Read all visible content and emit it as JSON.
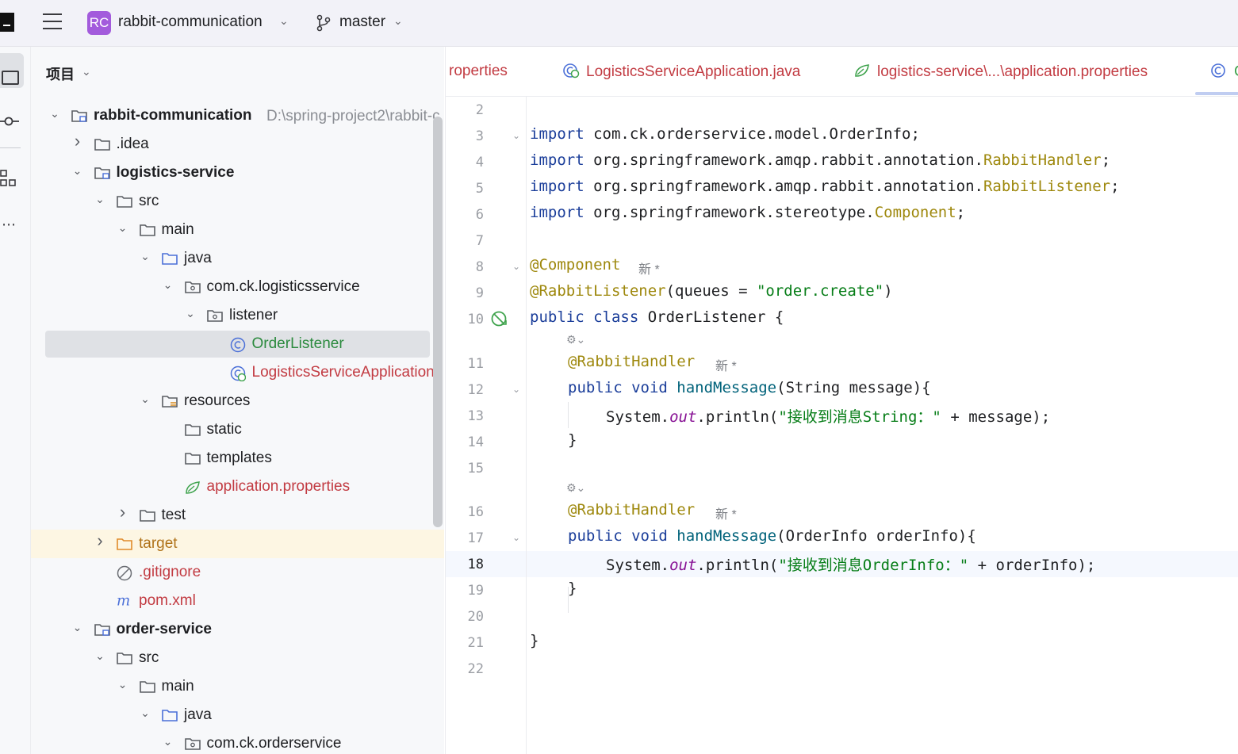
{
  "topbar": {
    "project_badge": "RC",
    "project_name": "rabbit-communication",
    "branch": "master"
  },
  "project_panel": {
    "title": "项目",
    "tree": [
      {
        "label": "rabbit-communication",
        "hint": "D:\\spring-project2\\rabbit-c",
        "style": "bold",
        "icon": "module-folder-icon",
        "toggle": "expanded"
      },
      {
        "label": ".idea",
        "style": "normal",
        "icon": "folder-icon",
        "toggle": "collapsed"
      },
      {
        "label": "logistics-service",
        "style": "bold",
        "icon": "module-folder-icon",
        "toggle": "expanded"
      },
      {
        "label": "src",
        "style": "normal",
        "icon": "folder-icon",
        "toggle": "expanded"
      },
      {
        "label": "main",
        "style": "normal",
        "icon": "folder-icon",
        "toggle": "expanded"
      },
      {
        "label": "java",
        "style": "normal",
        "icon": "source-folder-icon",
        "toggle": "expanded"
      },
      {
        "label": "com.ck.logisticsservice",
        "style": "normal",
        "icon": "package-icon",
        "toggle": "expanded"
      },
      {
        "label": "listener",
        "style": "normal",
        "icon": "package-icon",
        "toggle": "expanded"
      },
      {
        "label": "OrderListener",
        "style": "green",
        "icon": "class-icon",
        "toggle": "none",
        "selected": true
      },
      {
        "label": "LogisticsServiceApplication",
        "style": "red",
        "icon": "spring-boot-class-icon",
        "toggle": "none"
      },
      {
        "label": "resources",
        "style": "normal",
        "icon": "resources-folder-icon",
        "toggle": "expanded"
      },
      {
        "label": "static",
        "style": "normal",
        "icon": "folder-icon",
        "toggle": "none"
      },
      {
        "label": "templates",
        "style": "normal",
        "icon": "folder-icon",
        "toggle": "none"
      },
      {
        "label": "application.properties",
        "style": "red",
        "icon": "spring-properties-icon",
        "toggle": "none"
      },
      {
        "label": "test",
        "style": "normal",
        "icon": "folder-icon",
        "toggle": "collapsed"
      },
      {
        "label": "target",
        "style": "orange",
        "icon": "excluded-folder-icon",
        "toggle": "collapsed",
        "highlight": true
      },
      {
        "label": ".gitignore",
        "style": "red",
        "icon": "ignored-file-icon",
        "toggle": "none"
      },
      {
        "label": "pom.xml",
        "style": "red",
        "icon": "maven-icon",
        "toggle": "none"
      },
      {
        "label": "order-service",
        "style": "bold",
        "icon": "module-folder-icon",
        "toggle": "expanded"
      },
      {
        "label": "src",
        "style": "normal",
        "icon": "folder-icon",
        "toggle": "expanded"
      },
      {
        "label": "main",
        "style": "normal",
        "icon": "folder-icon",
        "toggle": "expanded"
      },
      {
        "label": "java",
        "style": "normal",
        "icon": "source-folder-icon",
        "toggle": "expanded"
      },
      {
        "label": "com.ck.orderservice",
        "style": "normal",
        "icon": "package-icon",
        "toggle": "expanded"
      }
    ]
  },
  "editor": {
    "tabs": [
      {
        "label": "roperties",
        "icon": ""
      },
      {
        "label": "LogisticsServiceApplication.java",
        "icon": "spring-boot-class-icon"
      },
      {
        "label": "logistics-service\\...\\application.properties",
        "icon": "spring-properties-icon"
      },
      {
        "label": "C",
        "icon": "class-icon"
      }
    ],
    "line_numbers": [
      "2",
      "3",
      "4",
      "5",
      "6",
      "7",
      "8",
      "9",
      "10",
      "11",
      "12",
      "13",
      "14",
      "15",
      "16",
      "17",
      "18",
      "19",
      "20",
      "21",
      "22"
    ],
    "current_line": "18",
    "author_hint": "新 *",
    "code": {
      "l3_kw": "import",
      "l3_rest": " com.ck.orderservice.model.OrderInfo;",
      "l4_kw": "import",
      "l4_pkg": " org.springframework.amqp.rabbit.annotation.",
      "l4_cls": "RabbitHandler",
      "l4_end": ";",
      "l5_kw": "import",
      "l5_pkg": " org.springframework.amqp.rabbit.annotation.",
      "l5_cls": "RabbitListener",
      "l5_end": ";",
      "l6_kw": "import",
      "l6_pkg": " org.springframework.stereotype.",
      "l6_cls": "Component",
      "l6_end": ";",
      "l8_ann": "@Component",
      "l9_ann": "@RabbitListener",
      "l9_a": "(queues = ",
      "l9_str": "\"order.create\"",
      "l9_b": ")",
      "l10_kw": "public class",
      "l10_rest": " OrderListener {",
      "l11_ann": "@RabbitHandler",
      "l12_kw": "public void",
      "l12_fn": " handMessage",
      "l12_rest": "(String message){",
      "l13_a": "System.",
      "l13_fld": "out",
      "l13_b": ".println(",
      "l13_str": "\"接收到消息String：\"",
      "l13_c": " + message);",
      "l14": "}",
      "l16_ann": "@RabbitHandler",
      "l17_kw": "public void",
      "l17_fn": " handMessage",
      "l17_rest": "(OrderInfo orderInfo){",
      "l18_a": "System.",
      "l18_fld": "out",
      "l18_b": ".println(",
      "l18_str": "\"接收到消息OrderInfo：\"",
      "l18_c": " + orderInfo);",
      "l19": "}",
      "l21": "}"
    }
  }
}
